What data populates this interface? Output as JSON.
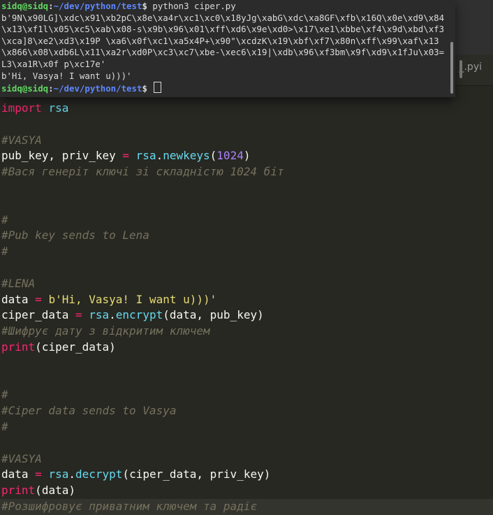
{
  "terminal": {
    "prompt": {
      "user_host": "sidq@sidq",
      "colon": ":",
      "path": "~/dev/python/test",
      "sign": "$"
    },
    "command": "python3 ciper.py",
    "output_bytes": "b'9N\\x90LG]\\xdc\\x91\\xb2pC\\x8e\\xa4r\\xc1\\xc0\\x18yJg\\xabG\\xdc\\xa8GF\\xfb\\x16Q\\x0e\\xd9\\x84\\x13\\xf1l\\x05\\xc5\\xab\\x08-s\\x9b\\x96\\x01\\xff\\xd6\\x9e\\xd0>\\x17\\xe1\\xbbe\\xf4\\x9d\\xbd\\xf3\\xca]8\\xe2\\xd3\\x19P \\xa6\\x0f\\xc1\\xa5x4P+\\x90\"\\xcdzK\\x19\\xbf\\xf7\\x80n\\xff\\x99\\xaf\\x13\\x866\\x08\\xdb6L\\x11\\xa2r\\xd0P\\xc3\\xc7\\xbe-\\xec6\\x19|\\xdb\\x96\\xf3bm\\x9f\\xd9\\x1fJu\\x03=L3\\xa1R\\x0f p\\xc17e'",
    "output_plain": "b'Hi, Vasya! I want u)))'"
  },
  "editor": {
    "tab_label": "_.pyi",
    "code": {
      "import_kw": "import",
      "import_mod": "rsa",
      "comment_vasya": "#VASYA",
      "newkeys_lhs": "pub_key, priv_key",
      "eq": " = ",
      "rsa": "rsa",
      "dot": ".",
      "newkeys_fn": "newkeys",
      "paren_open": "(",
      "paren_close": ")",
      "newkeys_arg": "1024",
      "comment_keys": "#Вася генеріт ключі зі складністю 1024 біт",
      "hash": "#",
      "comment_pub_sends": "#Pub key sends to Lena",
      "comment_lena": "#LENA",
      "data_var": "data",
      "data_str": "b'Hi, Vasya! I want u)))'",
      "ciper_var": "ciper_data",
      "encrypt_fn": "encrypt",
      "encrypt_args": "data, pub_key",
      "comment_encrypt": "#Шифрує дату з відкритим ключем",
      "print_fn": "print",
      "print_arg_ciper": "ciper_data",
      "comment_ciper_sends": "#Ciper data sends to Vasya",
      "decrypt_fn": "decrypt",
      "decrypt_args": "ciper_data, priv_key",
      "print_arg_data": "data",
      "comment_decrypt": "#Розшифровує приватним ключем та радіє"
    }
  },
  "colors": {
    "editor_bg": "#272822",
    "terminal_bg": "#2b2b2b",
    "keyword": "#f92672",
    "function": "#66d9ef",
    "number": "#ae81ff",
    "string": "#e6db74",
    "comment": "#75715e",
    "prompt_user": "#5fd75f",
    "prompt_path": "#5f87ff"
  }
}
